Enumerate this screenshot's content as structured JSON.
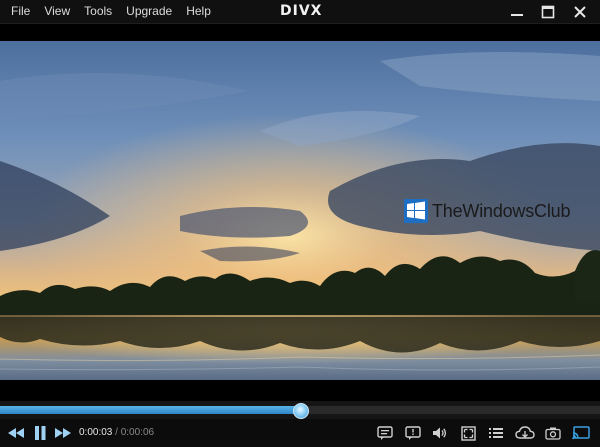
{
  "menu": {
    "items": [
      "File",
      "View",
      "Tools",
      "Upgrade",
      "Help"
    ]
  },
  "app": {
    "logo_text": "DIVX"
  },
  "window_controls": [
    "minimize-icon",
    "maximize-icon",
    "close-icon"
  ],
  "watermark": {
    "text": "TheWindowsClub",
    "logo": "windows-logo"
  },
  "playback": {
    "current_time": "0:00:03",
    "separator": "/",
    "total_time": "0:00:06",
    "progress": 0.5
  },
  "controls": {
    "left": [
      "rewind-icon",
      "pause-icon",
      "fast-forward-icon"
    ],
    "right": [
      "subtitles-icon",
      "audio-track-icon",
      "volume-icon",
      "fullscreen-icon",
      "playlist-icon",
      "cloud-icon",
      "snapshot-icon",
      "cast-icon"
    ]
  },
  "colors": {
    "accent": "#2f86c8",
    "seek_fill": "#4aa6dd",
    "cast_active": "#3aa0e0"
  }
}
